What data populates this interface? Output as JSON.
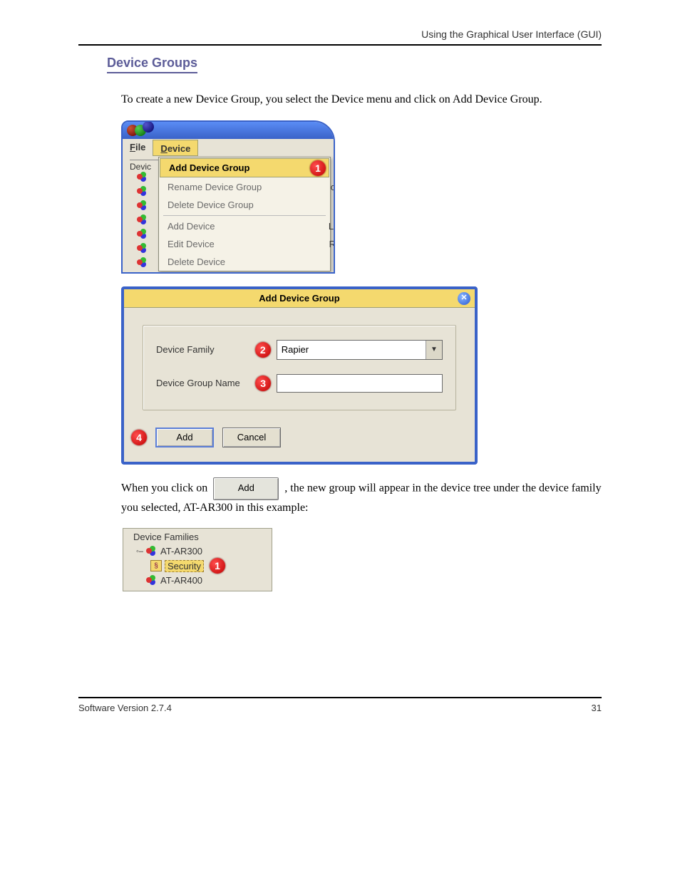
{
  "page_header": "Using the Graphical User Interface (GUI)",
  "section_title": "Device Groups",
  "intro_para": "To create a new Device Group, you select the Device menu and click on Add Device Group.",
  "shot1": {
    "menubar": {
      "file": "File",
      "device": "Device"
    },
    "tree_header": "Devic",
    "menu_items": {
      "add_group": "Add Device Group",
      "rename_group": "Rename Device Group",
      "delete_group": "Delete Device Group",
      "add_device": "Add Device",
      "edit_device": "Edit Device",
      "delete_device": "Delete Device"
    },
    "step": "1",
    "fragments": {
      "a": "o",
      "b": "Li",
      "c": "R"
    }
  },
  "dialog": {
    "title": "Add Device Group",
    "close": "✕",
    "family_label": "Device Family",
    "family_value": "Rapier",
    "group_label": "Device Group Name",
    "group_value": "",
    "add": "Add",
    "cancel": "Cancel",
    "steps": {
      "family": "2",
      "group": "3",
      "add": "4"
    }
  },
  "post_para_prefix": "When you click on ",
  "post_para_suffix": ", the new group will appear in the device tree under the device family you selected, AT-AR300 in this example:",
  "shot3": {
    "legend": "Device Families",
    "row1": "AT-AR300",
    "row2": "Security",
    "row3": "AT-AR400",
    "step": "1"
  },
  "footer": {
    "left": "Software Version 2.7.4",
    "right": "31"
  }
}
